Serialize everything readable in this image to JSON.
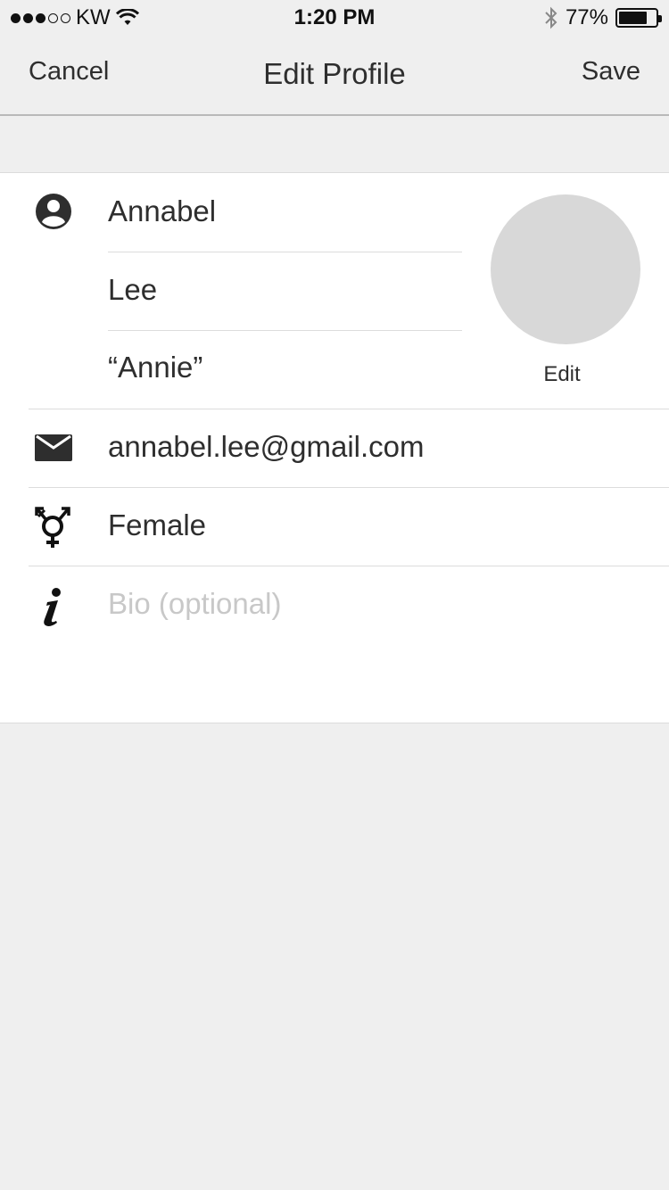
{
  "status_bar": {
    "carrier": "KW",
    "time": "1:20 PM",
    "battery_percent": "77%",
    "battery_level": 0.77,
    "signal_bars_filled": 3,
    "signal_bars_total": 5
  },
  "nav": {
    "cancel_label": "Cancel",
    "title": "Edit Profile",
    "save_label": "Save"
  },
  "profile": {
    "first_name": "Annabel",
    "last_name": "Lee",
    "nickname": "“Annie”",
    "avatar_edit_label": "Edit",
    "email": "annabel.lee@gmail.com",
    "gender": "Female",
    "bio_placeholder": "Bio (optional)",
    "bio_value": ""
  },
  "icons": {
    "name": "person-circle-icon",
    "email": "envelope-icon",
    "gender": "transgender-symbol-icon",
    "bio": "info-icon"
  },
  "colors": {
    "background": "#efefef",
    "card": "#ffffff",
    "text": "#2e2e2e",
    "placeholder": "#c8c8c8",
    "avatar": "#d8d8d8",
    "divider": "#dcdcdc"
  }
}
